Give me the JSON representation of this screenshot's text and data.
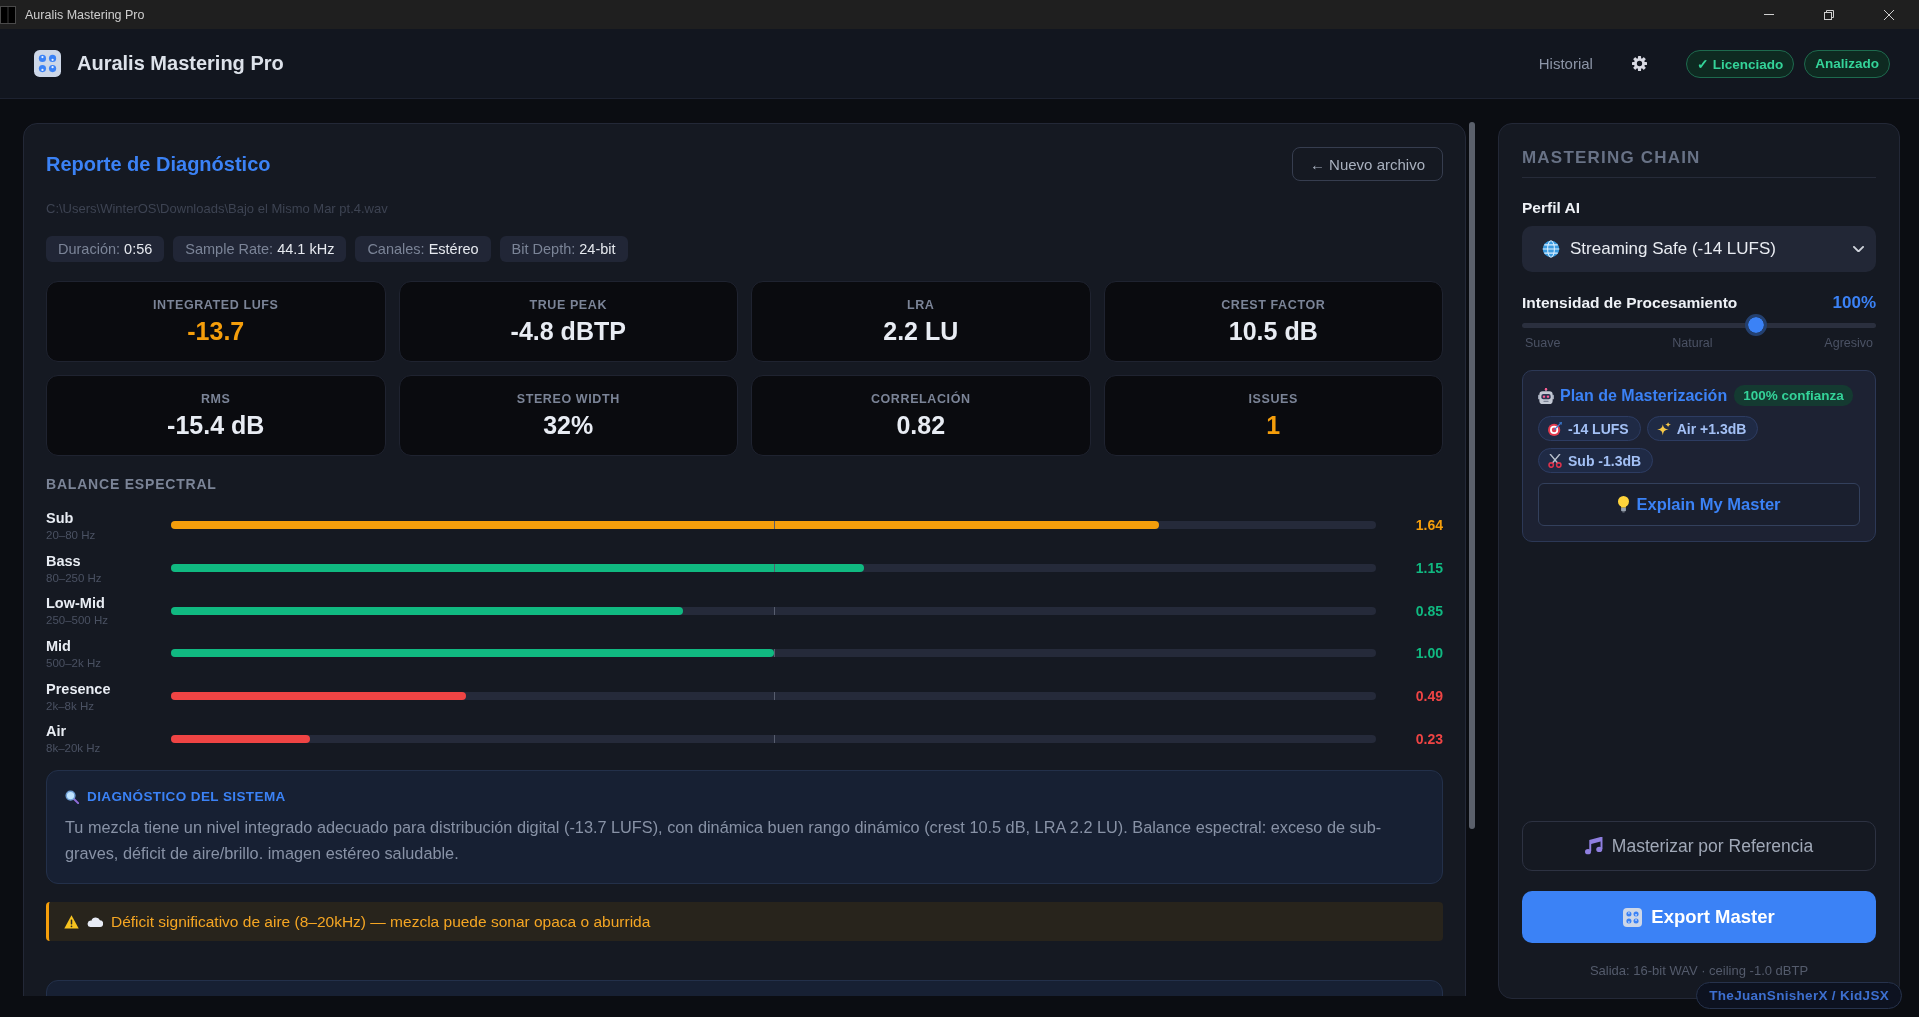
{
  "window": {
    "title": "Auralis Mastering Pro"
  },
  "header": {
    "app_name": "Auralis Mastering Pro",
    "nav_link": "Historial",
    "badges": [
      {
        "label": "✓ Licenciado"
      },
      {
        "label": "Analizado"
      }
    ]
  },
  "report": {
    "title": "Reporte de Diagnóstico",
    "back_button": "← Nuevo archivo",
    "file_path": "C:\\Users\\WinterOS\\Downloads\\Bajo el Mismo Mar pt.4.wav",
    "info_chips": [
      {
        "label": "Duración:",
        "value": "0:56"
      },
      {
        "label": "Sample Rate:",
        "value": "44.1 kHz"
      },
      {
        "label": "Canales:",
        "value": "Estéreo"
      },
      {
        "label": "Bit Depth:",
        "value": "24-bit"
      }
    ],
    "metrics": [
      {
        "label": "INTEGRATED LUFS",
        "value": "-13.7",
        "highlighted": true
      },
      {
        "label": "TRUE PEAK",
        "value": "-4.8 dBTP",
        "highlighted": false
      },
      {
        "label": "LRA",
        "value": "2.2 LU",
        "highlighted": false
      },
      {
        "label": "CREST FACTOR",
        "value": "10.5 dB",
        "highlighted": false
      },
      {
        "label": "RMS",
        "value": "-15.4 dB",
        "highlighted": false
      },
      {
        "label": "STEREO WIDTH",
        "value": "32%",
        "highlighted": false
      },
      {
        "label": "CORRELACIÓN",
        "value": "0.82",
        "highlighted": false
      },
      {
        "label": "ISSUES",
        "value": "1",
        "highlighted": true
      }
    ],
    "spectral_balance": {
      "title": "BALANCE ESPECTRAL",
      "bands": [
        {
          "name": "Sub",
          "range": "20–80 Hz",
          "level": 0.82,
          "reading": "1.64",
          "color": "#f59e0b"
        },
        {
          "name": "Bass",
          "range": "80–250 Hz",
          "level": 0.575,
          "reading": "1.15",
          "color": "#10b981"
        },
        {
          "name": "Low-Mid",
          "range": "250–500 Hz",
          "level": 0.425,
          "reading": "0.85",
          "color": "#10b981"
        },
        {
          "name": "Mid",
          "range": "500–2k Hz",
          "level": 0.5,
          "reading": "1.00",
          "color": "#10b981"
        },
        {
          "name": "Presence",
          "range": "2k–8k Hz",
          "level": 0.245,
          "reading": "0.49",
          "color": "#ef4444"
        },
        {
          "name": "Air",
          "range": "8k–20k Hz",
          "level": 0.115,
          "reading": "0.23",
          "color": "#ef4444"
        }
      ]
    },
    "diagnosis": {
      "title": "DIAGNÓSTICO DEL SISTEMA",
      "text": "Tu mezcla tiene un nivel integrado adecuado para distribución digital (-13.7 LUFS), con dinámica buen rango dinámico (crest 10.5 dB, LRA 2.2 LU). Balance espectral: exceso de sub-graves, déficit de aire/brillo. imagen estéreo saludable."
    },
    "alerts": [
      {
        "text": "Déficit significativo de aire (8–20kHz) — mezcla puede sonar opaca o aburrida"
      }
    ]
  },
  "mastering_chain": {
    "title": "MASTERING CHAIN",
    "profile": {
      "label": "Perfil AI",
      "value": "Streaming Safe (-14 LUFS)"
    },
    "intensity": {
      "label": "Intensidad de Procesamiento",
      "reading": "100%",
      "level": 0.66,
      "scale_labels": [
        "Suave",
        "Natural",
        "Agresivo"
      ]
    },
    "plan": {
      "title": "Plan de Masterización",
      "confidence": "100% confianza",
      "steps": [
        {
          "kind": "target",
          "label": "-14 LUFS"
        },
        {
          "kind": "boost",
          "label": "Air +1.3dB"
        },
        {
          "kind": "cut",
          "label": "Sub -1.3dB"
        }
      ],
      "explain_button": "Explain My Master"
    },
    "reference_button": "Masterizar por Referencia",
    "export_button": "Export Master",
    "output_note": "Salida: 16-bit WAV · ceiling -1.0 dBTP"
  },
  "credit": "TheJuanSnisherX / KidJSX"
}
